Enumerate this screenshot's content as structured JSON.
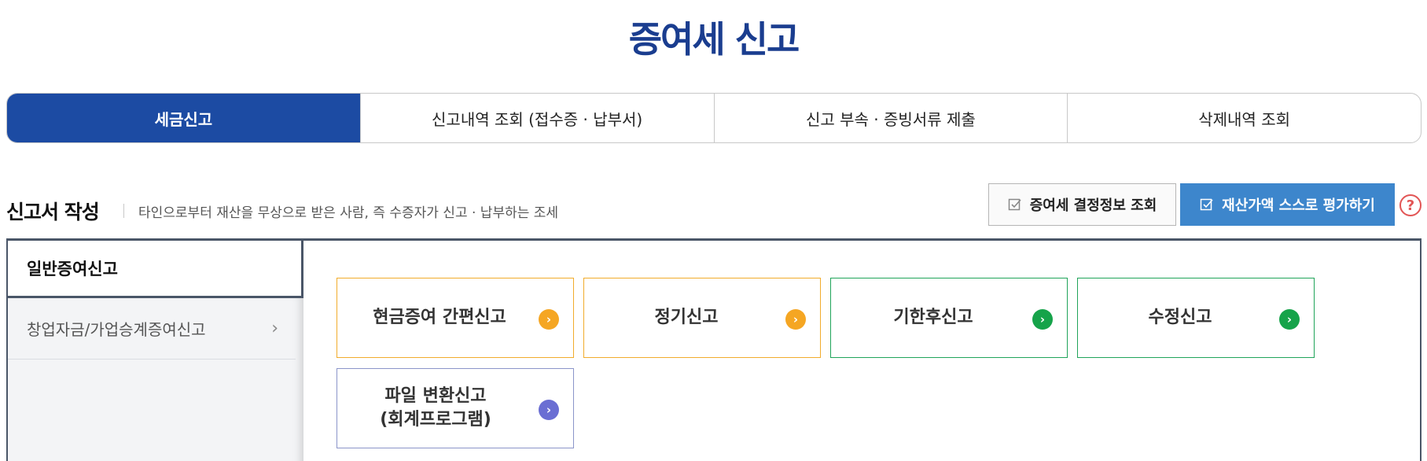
{
  "page": {
    "title": "증여세 신고"
  },
  "tabs": [
    {
      "label": "세금신고",
      "active": true
    },
    {
      "label": "신고내역 조회 (접수증 · 납부서)",
      "active": false
    },
    {
      "label": "신고 부속 · 증빙서류 제출",
      "active": false
    },
    {
      "label": "삭제내역 조회",
      "active": false
    }
  ],
  "section": {
    "title": "신고서 작성",
    "description": "타인으로부터 재산을 무상으로 받은 사람, 즉 수증자가 신고 · 납부하는 조세"
  },
  "actions": {
    "info_button": "증여세 결정정보 조회",
    "eval_button": "재산가액 스스로 평가하기",
    "help_icon": "?"
  },
  "side_menu": {
    "active_item": "일반증여신고",
    "items": [
      {
        "label": "창업자금/가업승계증여신고",
        "chevron": "›"
      }
    ]
  },
  "cards": [
    {
      "label": "현금증여 간편신고",
      "color": "#f5a623"
    },
    {
      "label": "정기신고",
      "color": "#f5a623"
    },
    {
      "label": "기한후신고",
      "color": "#16a34a"
    },
    {
      "label": "수정신고",
      "color": "#16a34a"
    },
    {
      "label_line1": "파일 변환신고",
      "label_line2": "(회계프로그램)",
      "color": "#6a6ed3"
    }
  ],
  "card_arrow": "›",
  "colors": {
    "brand_blue": "#1a3d8f",
    "tab_active": "#1c4ba3",
    "eval_button": "#3d86cc",
    "help_red": "#e25555"
  }
}
